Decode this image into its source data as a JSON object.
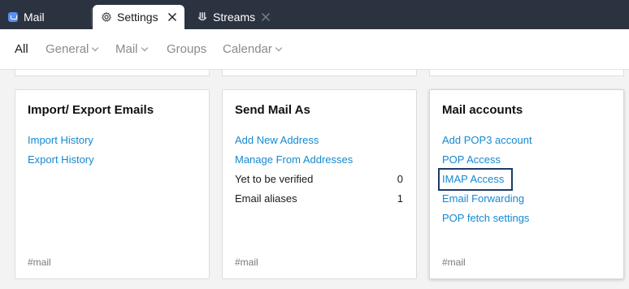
{
  "tabs": {
    "mail": "Mail",
    "settings": "Settings",
    "streams": "Streams"
  },
  "nav": {
    "all": "All",
    "general": "General",
    "mail": "Mail",
    "groups": "Groups",
    "calendar": "Calendar"
  },
  "cards": {
    "import_export": {
      "title": "Import/ Export Emails",
      "links": [
        "Import History",
        "Export History"
      ],
      "tag": "#mail"
    },
    "send_mail_as": {
      "title": "Send Mail As",
      "links": [
        "Add New Address",
        "Manage From Addresses"
      ],
      "rows": [
        {
          "label": "Yet to be verified",
          "count": "0"
        },
        {
          "label": "Email aliases",
          "count": "1"
        }
      ],
      "tag": "#mail"
    },
    "mail_accounts": {
      "title": "Mail accounts",
      "links": [
        "Add POP3 account",
        "POP Access",
        "IMAP Access",
        "Email Forwarding",
        "POP fetch settings"
      ],
      "tag": "#mail"
    }
  },
  "colors": {
    "link": "#1589d1",
    "tabbar": "#2b3340",
    "highlight_border": "#1c3b66"
  }
}
